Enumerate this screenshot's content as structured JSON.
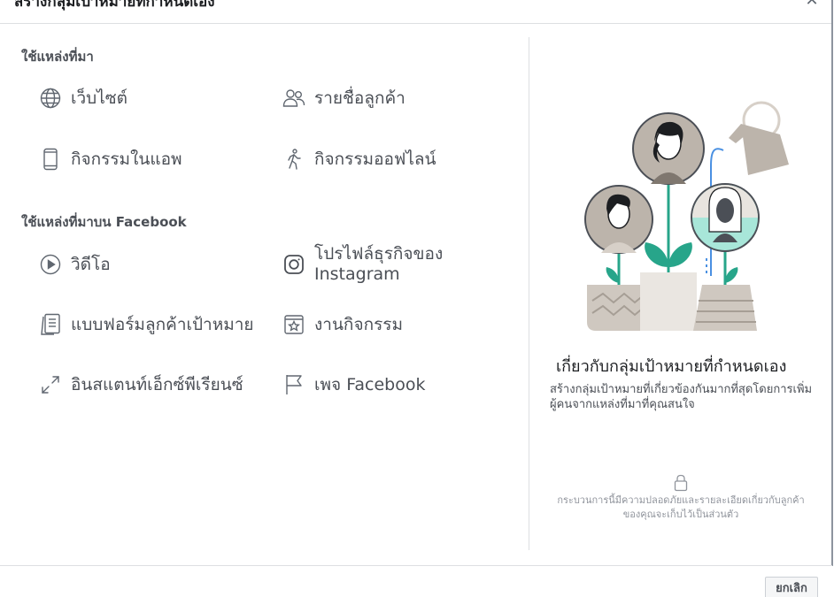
{
  "dialog": {
    "title": "สร้างกลุ่มเป้าหมายที่กำหนดเอง",
    "close_icon": "close-icon"
  },
  "sources": {
    "title": "ใช้แหล่งที่มา",
    "items": [
      {
        "label": "เว็บไซต์",
        "icon": "globe-icon"
      },
      {
        "label": "รายชื่อลูกค้า",
        "icon": "people-icon"
      },
      {
        "label": "กิจกรรมในแอพ",
        "icon": "phone-icon"
      },
      {
        "label": "กิจกรรมออฟไลน์",
        "icon": "walking-person-icon"
      }
    ]
  },
  "facebook_sources": {
    "title": "ใช้แหล่งที่มาบน Facebook",
    "items": [
      {
        "label": "วิดีโอ",
        "icon": "play-icon"
      },
      {
        "label": "โปรไฟล์ธุรกิจของ Instagram",
        "icon": "instagram-icon"
      },
      {
        "label": "แบบฟอร์มลูกค้าเป้าหมาย",
        "icon": "form-icon"
      },
      {
        "label": "งานกิจกรรม",
        "icon": "event-star-icon"
      },
      {
        "label": "อินสแตนท์เอ็กซ์พีเรียนซ์",
        "icon": "expand-icon"
      },
      {
        "label": "เพจ Facebook",
        "icon": "flag-icon"
      }
    ]
  },
  "info_panel": {
    "title": "เกี่ยวกับกลุ่มเป้าหมายที่กำหนดเอง",
    "description": "สร้างกลุ่มเป้าหมายที่เกี่ยวข้องกันมากที่สุดโดยการเพิ่มผู้คนจากแหล่งที่มาที่คุณสนใจ",
    "privacy_note": "กระบวนการนี้มีความปลอดภัยและรายละเอียดเกี่ยวกับลูกค้าของคุณจะเก็บไว้เป็นส่วนตัว"
  },
  "footer": {
    "cancel_label": "ยกเลิก"
  },
  "colors": {
    "icon": "#606770",
    "text": "#4b4f56",
    "accent_teal": "#27a58a",
    "illustration_gray": "#bcb4ab"
  }
}
